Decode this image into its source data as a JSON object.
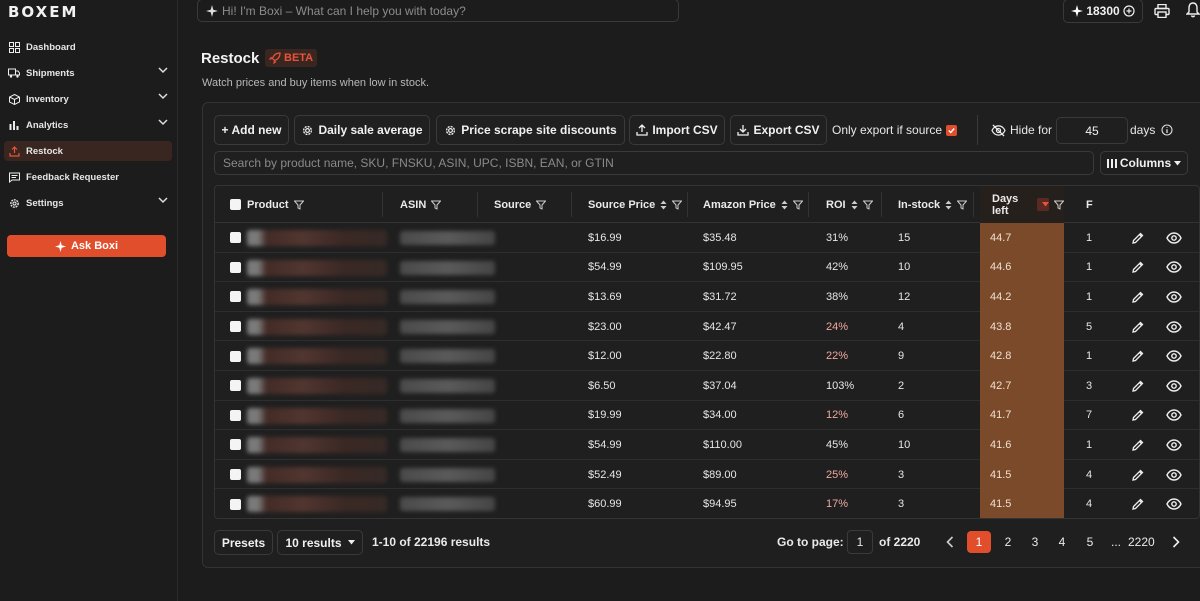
{
  "app": {
    "logo": "BOXEM"
  },
  "sidebar": {
    "items": [
      {
        "label": "Dashboard",
        "icon": "dashboard-icon",
        "has_chevron": false,
        "active": false
      },
      {
        "label": "Shipments",
        "icon": "truck-icon",
        "has_chevron": true,
        "active": false
      },
      {
        "label": "Inventory",
        "icon": "box-icon",
        "has_chevron": true,
        "active": false
      },
      {
        "label": "Analytics",
        "icon": "bar-chart-icon",
        "has_chevron": true,
        "active": false
      },
      {
        "label": "Restock",
        "icon": "restock-icon",
        "has_chevron": false,
        "active": true
      },
      {
        "label": "Feedback Requester",
        "icon": "message-icon",
        "has_chevron": false,
        "active": false
      },
      {
        "label": "Settings",
        "icon": "gear-icon",
        "has_chevron": true,
        "active": false
      }
    ],
    "ask_button": "Ask Boxi"
  },
  "topbar": {
    "boxi_placeholder": "Hi! I'm Boxi – What can I help you with today?",
    "credits": "18300"
  },
  "header": {
    "title": "Restock",
    "badge": "BETA",
    "subtitle": "Watch prices and buy items when low in stock."
  },
  "toolbar": {
    "add_new": "+ Add new",
    "daily_sale": "Daily sale average",
    "price_scrape": "Price scrape site discounts",
    "import_csv": "Import CSV",
    "export_csv": "Export CSV",
    "only_export": "Only export if source",
    "hide_for": "Hide for",
    "hide_days_value": "45",
    "days_label": "days",
    "search_placeholder": "Search by product name, SKU, FNSKU, ASIN, UPC, ISBN, EAN, or GTIN",
    "columns": "Columns"
  },
  "table": {
    "headers": {
      "product": "Product",
      "asin": "ASIN",
      "source": "Source",
      "source_price": "Source Price",
      "amazon_price": "Amazon Price",
      "roi": "ROI",
      "in_stock": "In-stock",
      "days_left": "Days left",
      "next": "F"
    },
    "rows": [
      {
        "source_price": "$16.99",
        "amazon_price": "$35.48",
        "roi": "31%",
        "roi_low": false,
        "in_stock": "15",
        "days_left": "44.7",
        "next": "1"
      },
      {
        "source_price": "$54.99",
        "amazon_price": "$109.95",
        "roi": "42%",
        "roi_low": false,
        "in_stock": "10",
        "days_left": "44.6",
        "next": "1"
      },
      {
        "source_price": "$13.69",
        "amazon_price": "$31.72",
        "roi": "38%",
        "roi_low": false,
        "in_stock": "12",
        "days_left": "44.2",
        "next": "1"
      },
      {
        "source_price": "$23.00",
        "amazon_price": "$42.47",
        "roi": "24%",
        "roi_low": true,
        "in_stock": "4",
        "days_left": "43.8",
        "next": "5"
      },
      {
        "source_price": "$12.00",
        "amazon_price": "$22.80",
        "roi": "22%",
        "roi_low": true,
        "in_stock": "9",
        "days_left": "42.8",
        "next": "1"
      },
      {
        "source_price": "$6.50",
        "amazon_price": "$37.04",
        "roi": "103%",
        "roi_low": false,
        "in_stock": "2",
        "days_left": "42.7",
        "next": "3"
      },
      {
        "source_price": "$19.99",
        "amazon_price": "$34.00",
        "roi": "12%",
        "roi_low": true,
        "in_stock": "6",
        "days_left": "41.7",
        "next": "7"
      },
      {
        "source_price": "$54.99",
        "amazon_price": "$110.00",
        "roi": "45%",
        "roi_low": false,
        "in_stock": "10",
        "days_left": "41.6",
        "next": "1"
      },
      {
        "source_price": "$52.49",
        "amazon_price": "$89.00",
        "roi": "25%",
        "roi_low": true,
        "in_stock": "3",
        "days_left": "41.5",
        "next": "4"
      },
      {
        "source_price": "$60.99",
        "amazon_price": "$94.95",
        "roi": "17%",
        "roi_low": true,
        "in_stock": "3",
        "days_left": "41.5",
        "next": "4"
      }
    ]
  },
  "footer": {
    "presets": "Presets",
    "per_page": "10 results",
    "results_text": "1-10 of 22196 results",
    "goto_label": "Go to page:",
    "goto_value": "1",
    "of_pages": "of 2220",
    "pages": [
      "1",
      "2",
      "3",
      "4",
      "5",
      "...",
      "2220"
    ],
    "active_page": "1"
  },
  "colors": {
    "accent": "#e04e2c",
    "days_left_bg": "#7a4a2a",
    "roi_low": "#f0a8a0"
  }
}
